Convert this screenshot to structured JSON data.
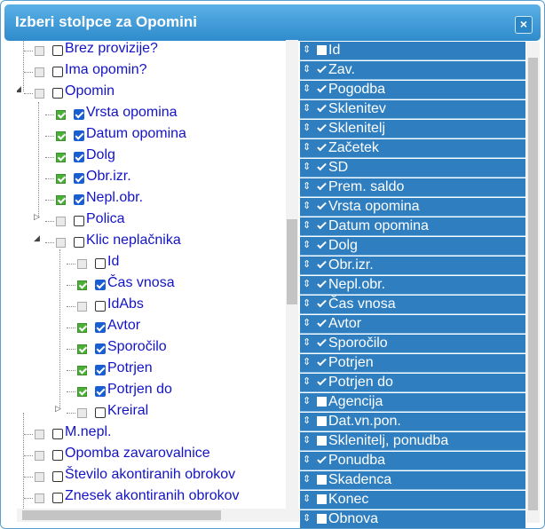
{
  "dialog": {
    "title": "Izberi stolpce za Opomini",
    "close_label": "×"
  },
  "tree": [
    {
      "label": "Brez provizije?",
      "checked": false
    },
    {
      "label": "Ima opomin?",
      "checked": false
    },
    {
      "label": "Opomin",
      "checked": false,
      "expanded": true
    },
    {
      "label": "Vrsta opomina",
      "checked": true
    },
    {
      "label": "Datum opomina",
      "checked": true
    },
    {
      "label": "Dolg",
      "checked": true
    },
    {
      "label": "Obr.izr.",
      "checked": true
    },
    {
      "label": "Nepl.obr.",
      "checked": true
    },
    {
      "label": "Polica",
      "checked": false,
      "collapsed": true
    },
    {
      "label": "Klic neplačnika",
      "checked": false,
      "expanded": true
    },
    {
      "label": "Id",
      "checked": false
    },
    {
      "label": "Čas vnosa",
      "checked": true
    },
    {
      "label": "IdAbs",
      "checked": false
    },
    {
      "label": "Avtor",
      "checked": true
    },
    {
      "label": "Sporočilo",
      "checked": true
    },
    {
      "label": "Potrjen",
      "checked": true
    },
    {
      "label": "Potrjen do",
      "checked": true
    },
    {
      "label": "Kreiral",
      "checked": false
    },
    {
      "label": "M.nepl.",
      "checked": false
    },
    {
      "label": "Opomba zavarovalnice",
      "checked": false
    },
    {
      "label": "Število akontiranih obrokov",
      "checked": false
    },
    {
      "label": "Znesek akontiranih obrokov",
      "checked": false
    }
  ],
  "selected_columns": [
    {
      "label": "Id",
      "checked": false
    },
    {
      "label": "Zav.",
      "checked": true
    },
    {
      "label": "Pogodba",
      "checked": true
    },
    {
      "label": "Sklenitev",
      "checked": true
    },
    {
      "label": "Sklenitelj",
      "checked": true
    },
    {
      "label": "Začetek",
      "checked": true
    },
    {
      "label": "SD",
      "checked": true
    },
    {
      "label": "Prem. saldo",
      "checked": true
    },
    {
      "label": "Vrsta opomina",
      "checked": true
    },
    {
      "label": "Datum opomina",
      "checked": true
    },
    {
      "label": "Dolg",
      "checked": true
    },
    {
      "label": "Obr.izr.",
      "checked": true
    },
    {
      "label": "Nepl.obr.",
      "checked": true
    },
    {
      "label": "Čas vnosa",
      "checked": true
    },
    {
      "label": "Avtor",
      "checked": true
    },
    {
      "label": "Sporočilo",
      "checked": true
    },
    {
      "label": "Potrjen",
      "checked": true
    },
    {
      "label": "Potrjen do",
      "checked": true
    },
    {
      "label": "Agencija",
      "checked": false
    },
    {
      "label": "Dat.vn.pon.",
      "checked": false
    },
    {
      "label": "Sklenitelj, ponudba",
      "checked": false
    },
    {
      "label": "Ponudba",
      "checked": true
    },
    {
      "label": "Skadenca",
      "checked": false
    },
    {
      "label": "Konec",
      "checked": false
    },
    {
      "label": "Obnova",
      "checked": false
    }
  ],
  "colors": {
    "title_bar": "#3a97d6",
    "list_item": "#2f7fc0",
    "link_text": "#1313c6",
    "checked_green": "#4caf3a"
  },
  "icons": {
    "close": "close-icon",
    "drag_handle": "drag-handle-icon"
  }
}
